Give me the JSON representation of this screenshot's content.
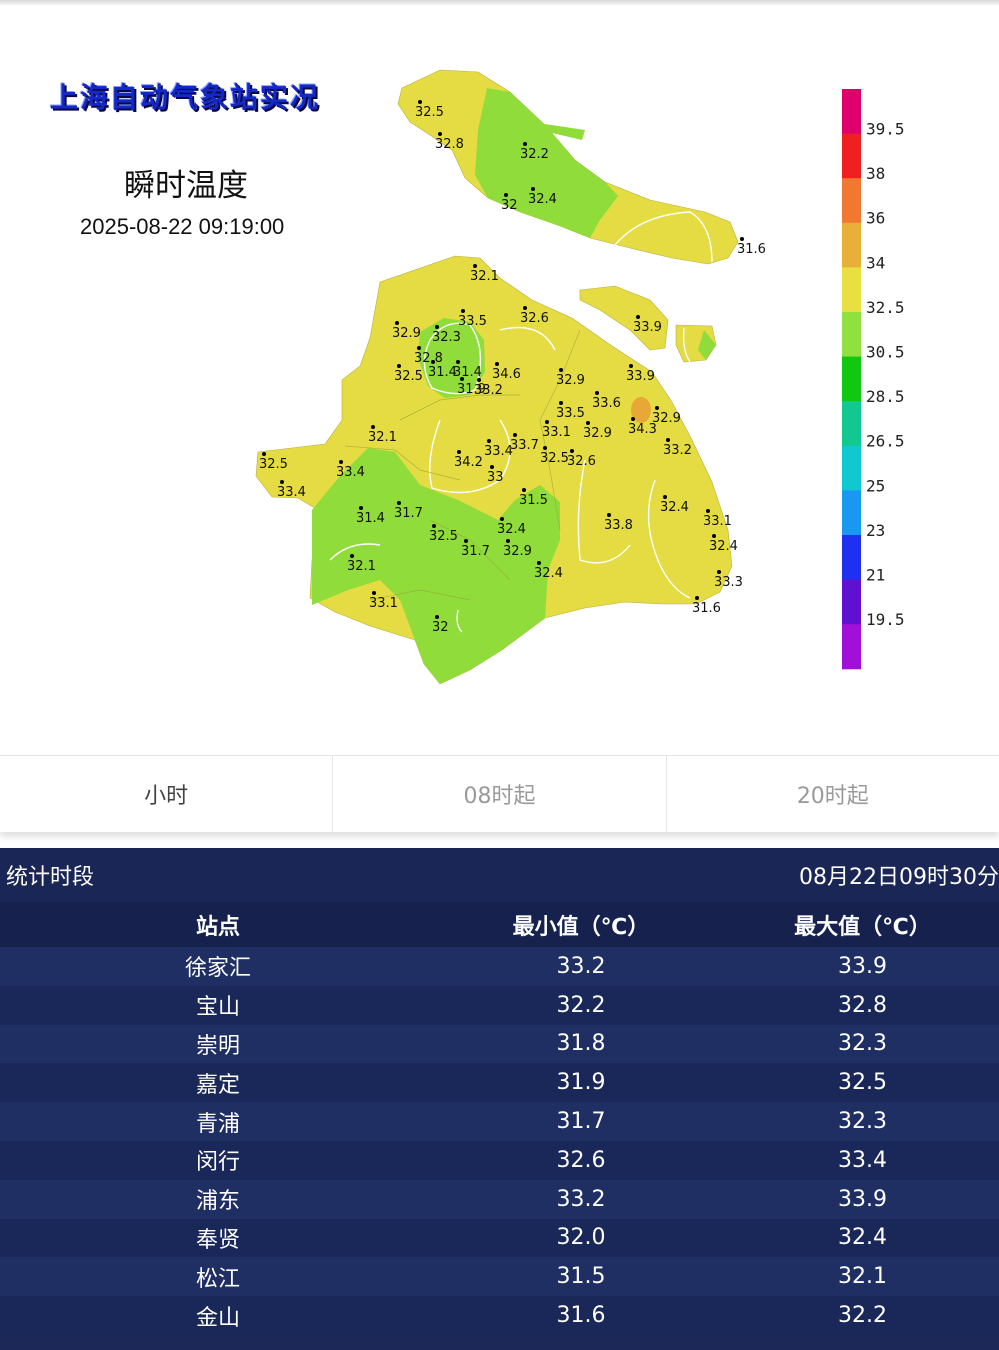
{
  "map": {
    "title": "上海自动气象站实况",
    "variable": "瞬时温度",
    "timestamp": "2025-08-22 09:19:00",
    "colors": {
      "green": "#8fdc3a",
      "yellow": "#e4dc42",
      "orange": "#e8a838"
    },
    "legend": [
      {
        "label": "39.5",
        "color": "#e0006c"
      },
      {
        "label": "38",
        "color": "#f02020"
      },
      {
        "label": "36",
        "color": "#f07830"
      },
      {
        "label": "34",
        "color": "#e8b038"
      },
      {
        "label": "32.5",
        "color": "#e8e040"
      },
      {
        "label": "30.5",
        "color": "#90e040"
      },
      {
        "label": "28.5",
        "color": "#10c810"
      },
      {
        "label": "26.5",
        "color": "#10c890"
      },
      {
        "label": "25",
        "color": "#10c8d0"
      },
      {
        "label": "23",
        "color": "#1898f0"
      },
      {
        "label": "21",
        "color": "#2030f0"
      },
      {
        "label": "19.5",
        "color": "#6010d0"
      },
      {
        "label": "",
        "color": "#a010d8"
      }
    ],
    "stations": [
      "32.5",
      "32.8",
      "32.2",
      "32",
      "32.4",
      "31.6",
      "33.9",
      "32.1",
      "32.9",
      "33.5",
      "32.3",
      "32.6",
      "32.8",
      "31.4",
      "31.4",
      "32.5",
      "31.9",
      "33.2",
      "34.6",
      "32.9",
      "33.9",
      "33.6",
      "33.5",
      "34.3",
      "32.9",
      "32.1",
      "33.1",
      "32.9",
      "33.2",
      "33.7",
      "32.5",
      "32.6",
      "32.5",
      "33.4",
      "34.2",
      "33.4",
      "33",
      "33.4",
      "31.5",
      "32.4",
      "31.4",
      "31.7",
      "32.5",
      "32.4",
      "31.7",
      "32.9",
      "33.8",
      "33.1",
      "32.4",
      "32.1",
      "32.4",
      "33.3",
      "33.1",
      "31.6",
      "32"
    ]
  },
  "tabs": [
    {
      "label": "小时",
      "active": true
    },
    {
      "label": "08时起",
      "active": false
    },
    {
      "label": "20时起",
      "active": false
    }
  ],
  "stats": {
    "period_label": "统计时段",
    "period_value": "08月22日09时30分",
    "columns": [
      "站点",
      "最小值（℃）",
      "最大值（℃）"
    ],
    "rows": [
      [
        "徐家汇",
        "33.2",
        "33.9"
      ],
      [
        "宝山",
        "32.2",
        "32.8"
      ],
      [
        "崇明",
        "31.8",
        "32.3"
      ],
      [
        "嘉定",
        "31.9",
        "32.5"
      ],
      [
        "青浦",
        "31.7",
        "32.3"
      ],
      [
        "闵行",
        "32.6",
        "33.4"
      ],
      [
        "浦东",
        "33.2",
        "33.9"
      ],
      [
        "奉贤",
        "32.0",
        "32.4"
      ],
      [
        "松江",
        "31.5",
        "32.1"
      ],
      [
        "金山",
        "31.6",
        "32.2"
      ]
    ]
  }
}
